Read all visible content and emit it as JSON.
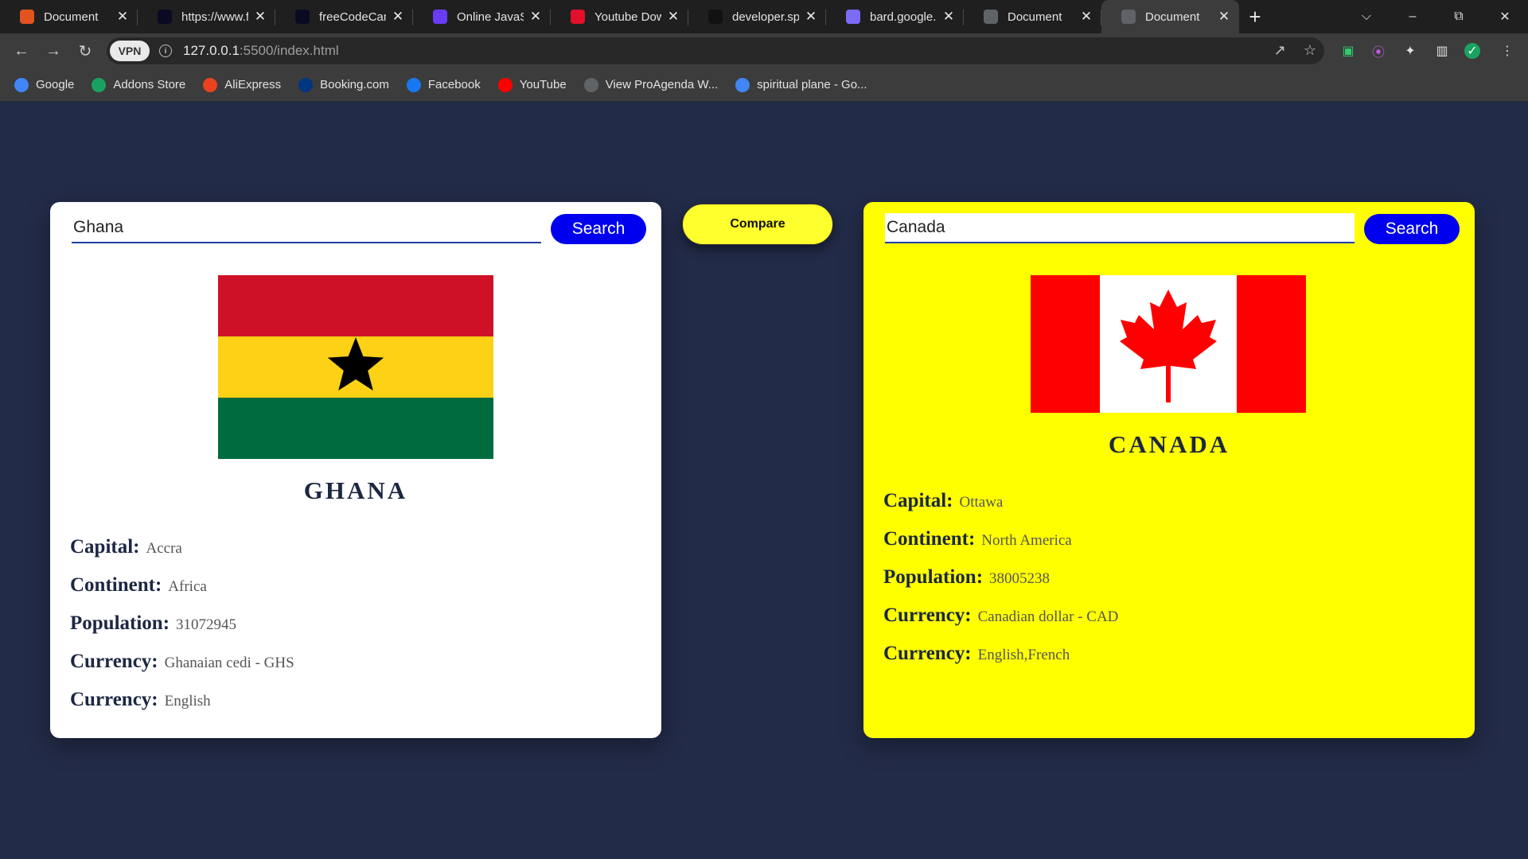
{
  "browser": {
    "tabs": [
      {
        "title": "Document",
        "favicon": "xampp-icon",
        "color": "#e2531f",
        "active": false
      },
      {
        "title": "https://www.fr",
        "favicon": "freecodecamp-icon",
        "color": "#0a0a23",
        "active": false
      },
      {
        "title": "freeCodeCamp",
        "favicon": "freecodecamp-icon",
        "color": "#0a0a23",
        "active": false
      },
      {
        "title": "Online JavaScr",
        "favicon": "playcode-icon",
        "color": "#6a3cf5",
        "active": false
      },
      {
        "title": "Youtube Down",
        "favicon": "download-icon",
        "color": "#e3102b",
        "active": false
      },
      {
        "title": "developer.spo",
        "favicon": "spotify-icon",
        "color": "#111111",
        "active": false
      },
      {
        "title": "bard.google.c",
        "favicon": "bard-icon",
        "color": "#7b6cf6",
        "active": false
      },
      {
        "title": "Document",
        "favicon": "globe-icon",
        "color": "#5f6368",
        "active": false
      },
      {
        "title": "Document",
        "favicon": "globe-icon",
        "color": "#5f6368",
        "active": true
      }
    ],
    "url": {
      "host": "127.0.0.1",
      "path": ":5500/index.html"
    },
    "vpn_label": "VPN",
    "bookmarks": [
      {
        "label": "Google",
        "icon": "google-icon",
        "color": "#4285f4"
      },
      {
        "label": "Addons Store",
        "icon": "addons-store-icon",
        "color": "#1aa260"
      },
      {
        "label": "AliExpress",
        "icon": "aliexpress-icon",
        "color": "#e8431e"
      },
      {
        "label": "Booking.com",
        "icon": "booking-icon",
        "color": "#003580"
      },
      {
        "label": "Facebook",
        "icon": "facebook-icon",
        "color": "#1877f2"
      },
      {
        "label": "YouTube",
        "icon": "youtube-icon",
        "color": "#ff0000"
      },
      {
        "label": "View ProAgenda W...",
        "icon": "globe-icon",
        "color": "#5f6368"
      },
      {
        "label": "spiritual plane - Go...",
        "icon": "google-icon",
        "color": "#4285f4"
      }
    ]
  },
  "page": {
    "compare_label": "Compare",
    "left": {
      "search_value": "Ghana",
      "search_button": "Search",
      "country_name": "GHANA",
      "flag": {
        "type": "ghana",
        "colors": [
          "#ce1126",
          "#fcd116",
          "#006b3f",
          "#000000"
        ]
      },
      "background": "#ffffff",
      "fields": [
        {
          "label": "Capital:",
          "value": "Accra"
        },
        {
          "label": "Continent:",
          "value": "Africa"
        },
        {
          "label": "Population:",
          "value": "31072945"
        },
        {
          "label": "Currency:",
          "value": "Ghanaian cedi - GHS"
        },
        {
          "label": "Currency:",
          "value": "English"
        }
      ]
    },
    "right": {
      "search_value": "Canada",
      "search_button": "Search",
      "country_name": "CANADA",
      "flag": {
        "type": "canada",
        "colors": [
          "#ff0000",
          "#ffffff"
        ]
      },
      "background": "#ffff00",
      "fields": [
        {
          "label": "Capital:",
          "value": "Ottawa"
        },
        {
          "label": "Continent:",
          "value": "North America"
        },
        {
          "label": "Population:",
          "value": "38005238"
        },
        {
          "label": "Currency:",
          "value": "Canadian dollar - CAD"
        },
        {
          "label": "Currency:",
          "value": "English,French"
        }
      ]
    }
  }
}
